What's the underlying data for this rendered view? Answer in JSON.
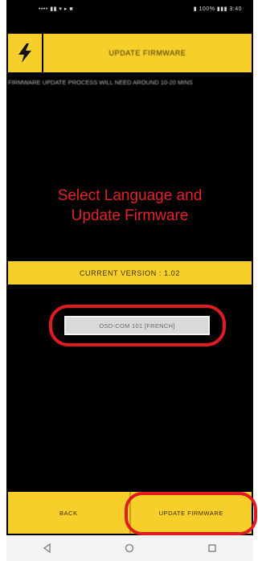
{
  "status_bar": {
    "left_text": "•••• ▮▮ ▾ ▸ ■",
    "right_text": "▮ 100% ▮▮▮ 3:40"
  },
  "header": {
    "title": "UPDATE FIRMWARE"
  },
  "info_text": "FIRMWARE UPDATE PROCESS WILL NEED AROUND 10-20 MINS",
  "headline": {
    "line1": "Select Language and",
    "line2": "Update Firmware"
  },
  "version_bar": {
    "text": "CURRENT VERSION : 1.02"
  },
  "language_select": {
    "value": "OSD-COM 101 [FRENCH]"
  },
  "bottom_bar": {
    "back_label": "BACK",
    "update_label": "UPDATE FIRMWARE"
  },
  "nav_bar": {
    "back": "◁",
    "home": "○",
    "recents": "□"
  },
  "colors": {
    "accent_yellow": "#f6cf2a",
    "highlight_red": "#e11b22",
    "headline_red": "#e2242b",
    "background": "#000000"
  }
}
